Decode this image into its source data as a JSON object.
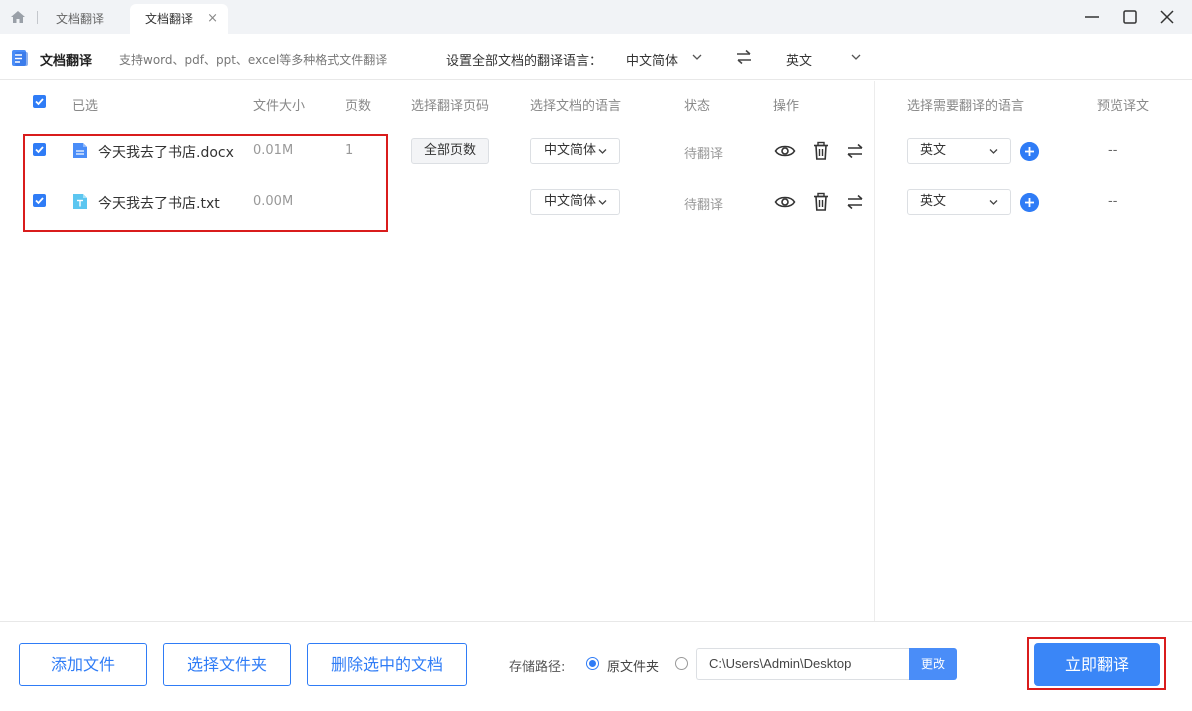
{
  "titlebar": {
    "tab_inactive": "文档翻译",
    "tab_active": "文档翻译",
    "tab_close": "×"
  },
  "header": {
    "title": "文档翻译",
    "subtitle": "支持word、pdf、ppt、excel等多种格式文件翻译",
    "lang_label": "设置全部文档的翻译语言：",
    "source_lang": "中文简体",
    "target_lang": "英文"
  },
  "table": {
    "columns": {
      "selected": "已选",
      "size": "文件大小",
      "pages": "页数",
      "page_range": "选择翻译页码",
      "doc_lang": "选择文档的语言",
      "status": "状态",
      "actions": "操作",
      "target_lang": "选择需要翻译的语言",
      "preview": "预览译文"
    },
    "rows": [
      {
        "name": "今天我去了书店.docx",
        "size": "0.01M",
        "pages": "1",
        "page_range": "全部页数",
        "doc_lang": "中文简体",
        "status": "待翻译",
        "target_lang": "英文",
        "preview": "--"
      },
      {
        "name": "今天我去了书店.txt",
        "size": "0.00M",
        "doc_lang": "中文简体",
        "status": "待翻译",
        "target_lang": "英文",
        "preview": "--"
      }
    ]
  },
  "footer": {
    "add_file": "添加文件",
    "select_folder": "选择文件夹",
    "delete_selected": "删除选中的文档",
    "save_path_label": "存储路径:",
    "option_original": "原文件夹",
    "path_value": "C:\\Users\\Admin\\Desktop",
    "change": "更改",
    "start": "立即翻译"
  },
  "colors": {
    "accent": "#2f7cf6",
    "highlight": "#d91c1c"
  }
}
